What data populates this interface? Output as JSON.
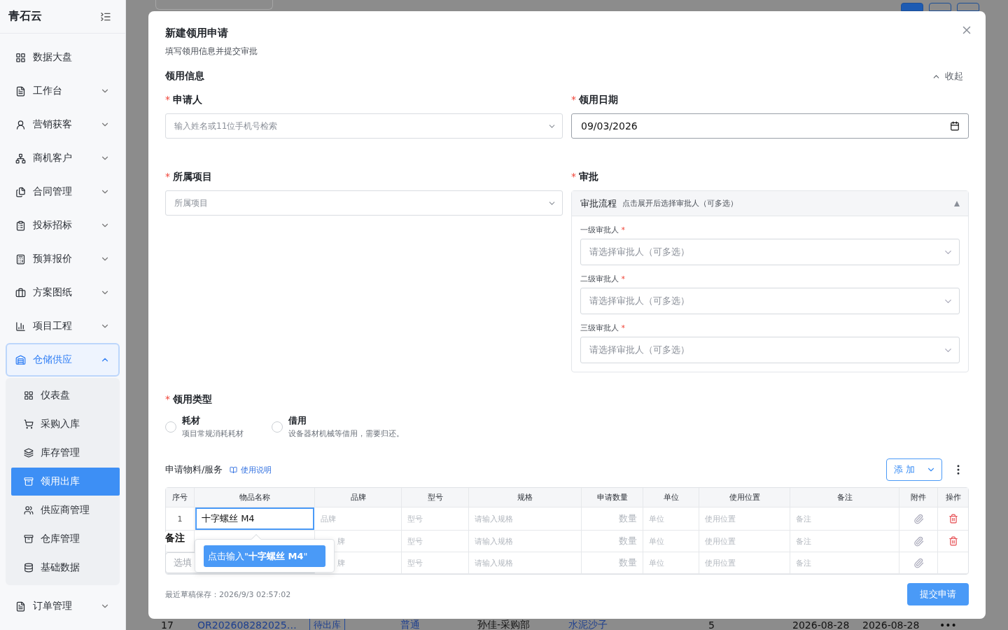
{
  "sidebar": {
    "brand": "青石云",
    "items": [
      {
        "label": "数据大盘",
        "kind": "link",
        "expanded": false,
        "selected": false
      },
      {
        "label": "工作台",
        "kind": "group",
        "expanded": false,
        "selected": false
      },
      {
        "label": "营销获客",
        "kind": "group",
        "expanded": false,
        "selected": false
      },
      {
        "label": "商机客户",
        "kind": "group",
        "expanded": false,
        "selected": false
      },
      {
        "label": "合同管理",
        "kind": "group",
        "expanded": false,
        "selected": false
      },
      {
        "label": "投标招标",
        "kind": "group",
        "expanded": false,
        "selected": false
      },
      {
        "label": "预算报价",
        "kind": "group",
        "expanded": false,
        "selected": false
      },
      {
        "label": "方案图纸",
        "kind": "group",
        "expanded": false,
        "selected": false
      },
      {
        "label": "项目工程",
        "kind": "group",
        "expanded": false,
        "selected": false
      },
      {
        "label": "仓储供应",
        "kind": "group",
        "expanded": true,
        "selected": true,
        "children": [
          {
            "label": "仪表盘",
            "selected": false
          },
          {
            "label": "采购入库",
            "selected": false
          },
          {
            "label": "库存管理",
            "selected": false
          },
          {
            "label": "领用出库",
            "selected": true
          },
          {
            "label": "供应商管理",
            "selected": false
          },
          {
            "label": "仓库管理",
            "selected": false
          },
          {
            "label": "基础数据",
            "selected": false
          }
        ]
      },
      {
        "label": "订单管理",
        "kind": "group",
        "expanded": false,
        "selected": false
      }
    ]
  },
  "background_row": [
    "17",
    "OR202608282025…",
    "待出库",
    "普通",
    "孙佳-采购部",
    "水泥沙子",
    "5",
    "2026-08-28",
    "2026-08-28",
    "•••"
  ],
  "dialog": {
    "title": "新建领用申请",
    "subtitle": "填写领用信息并提交审批",
    "section": "领用信息",
    "collapse": "收起",
    "applicant": {
      "required": "*",
      "label": "申请人",
      "placeholder": "输入姓名或11位手机号检索"
    },
    "date": {
      "required": "*",
      "label": "领用日期",
      "value": "09/03/2026"
    },
    "project": {
      "required": "*",
      "label": "所属项目",
      "placeholder": "所属项目"
    },
    "approval": {
      "required": "*",
      "label": "审批",
      "title": "审批流程",
      "hint": "点击展开后选择审批人（可多选）",
      "expanded": true,
      "levels": [
        {
          "label": "一级审批人",
          "required": "*",
          "placeholder": "请选择审批人（可多选）"
        },
        {
          "label": "二级审批人",
          "required": "*",
          "placeholder": "请选择审批人（可多选）"
        },
        {
          "label": "三级审批人",
          "required": "*",
          "placeholder": "请选择审批人（可多选）"
        }
      ]
    },
    "usage_type": {
      "required": "*",
      "label": "领用类型",
      "options": [
        {
          "title": "耗材",
          "desc": "项目常规消耗耗材",
          "selected": false
        },
        {
          "title": "借用",
          "desc": "设备器材机械等借用，需要归还。",
          "selected": false
        }
      ]
    },
    "materials": {
      "title": "申请物料/服务",
      "help": "使用说明",
      "add": "添 加",
      "columns": [
        "序号",
        "物品名称",
        "品牌",
        "型号",
        "规格",
        "申请数量",
        "单位",
        "使用位置",
        "备注",
        "附件",
        "操作"
      ],
      "rows": [
        {
          "index": "1",
          "name": "十字螺丝 M4",
          "brand": "品牌",
          "model": "型号",
          "spec": "请输入规格",
          "qty": "数量",
          "unit": "单位",
          "location": "使用位置",
          "remark": "备注",
          "deletable": true
        },
        {
          "brand": "牌",
          "model": "型号",
          "spec": "请输入规格",
          "qty": "数量",
          "unit": "单位",
          "location": "使用位置",
          "remark": "备注",
          "deletable": true
        },
        {
          "brand": "牌",
          "model": "型号",
          "spec": "请输入规格",
          "qty": "数量",
          "unit": "单位",
          "location": "使用位置",
          "remark": "备注",
          "deletable": false
        }
      ],
      "suggestion": "点击输入\"**十字螺丝 M4**\""
    },
    "remark": {
      "label": "备注",
      "placeholder": "选填"
    },
    "draft": "最近草稿保存：2026/9/3 02:57:02",
    "submit": "提交申请"
  }
}
